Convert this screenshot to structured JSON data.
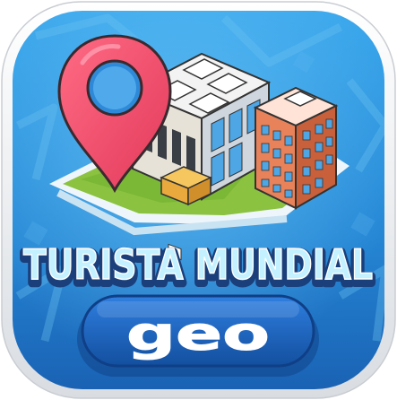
{
  "app": {
    "title": "TURISTA MUNDIAL",
    "subtitle": "geo"
  },
  "icons": {
    "pin": "map-pin-icon",
    "buildings": "isometric-buildings-icon",
    "map": "map-tile-icon"
  },
  "colors": {
    "background_blue": "#2a8fd6",
    "background_dark": "#1d63b3",
    "pin_red": "#f04e6a",
    "title_fill": "#bff0ff",
    "badge_blue": "#1a5fbf",
    "ground_green": "#8bc23f",
    "tower_orange": "#e8825a"
  }
}
